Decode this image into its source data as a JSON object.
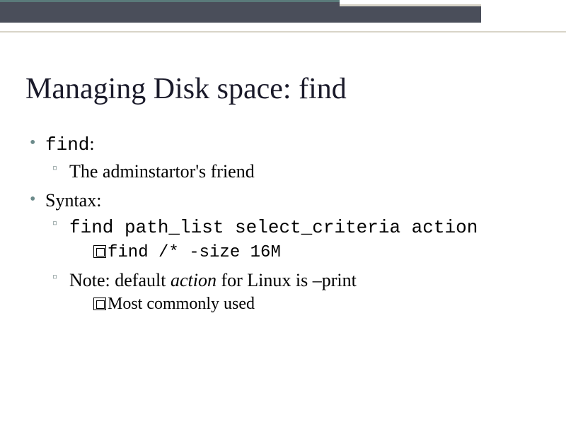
{
  "slide": {
    "title": "Managing Disk space: find",
    "items": [
      {
        "text_prefix": "",
        "code": "find",
        "text_suffix": ":",
        "subs": [
          {
            "text": "The adminstartor's friend"
          }
        ]
      },
      {
        "text": "Syntax:",
        "subs": [
          {
            "code": "find path_list select_criteria action",
            "subsubs": [
              {
                "code": "find /* -size 16M"
              }
            ]
          },
          {
            "mixed": {
              "pre": "Note: default ",
              "em": "action",
              "post": " for Linux is –print"
            },
            "subsubs": [
              {
                "text": "Most commonly used"
              }
            ]
          }
        ]
      }
    ]
  }
}
